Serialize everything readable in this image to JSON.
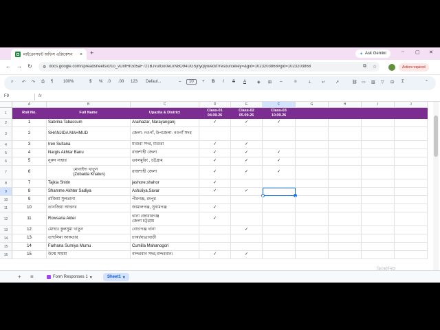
{
  "browser": {
    "tab_title": "মাইক্রোসফট অফিস এপ্লিকেশন",
    "tab_close": "×",
    "new_tab": "+",
    "gemini_label": "Ask Gemini",
    "url": "docs.google.com/spreadsheets/d/1o_vDnfHIGd5aF7z1BJvutGo0eLkN8O94UGSjriyqlyo/edit?resourcekey=&gid=1023203868#gid=1023203868",
    "action_required": "Action required",
    "win_min": "–",
    "win_max": "▢",
    "win_close": "✕",
    "back": "←",
    "forward": "→",
    "reload": "↻"
  },
  "toolbar": {
    "zoom": "100%",
    "currency": "$",
    "percent": "%",
    "format_123": "123",
    "font": "Defaul...",
    "font_size": "10",
    "bold": "B",
    "italic": "I",
    "strike": "S",
    "text_color": "A",
    "minus": "–",
    "plus": "+",
    "decimals_dec": ".0",
    "decimals_inc": ".00"
  },
  "formula_bar": {
    "cell_ref": "F9",
    "fx": "fx",
    "content": ""
  },
  "columns": [
    "A",
    "B",
    "C",
    "D",
    "E",
    "F",
    "G",
    "H",
    "I",
    "J"
  ],
  "header_row": {
    "roll": "Roll No.",
    "name": "Full Name",
    "upazila": "Upazila & District",
    "class1": "Class-01\n04.09.26",
    "class2": "Class-02\n05.09.26",
    "class3": "Class-03\n10.09.26"
  },
  "rows": [
    {
      "n": "2",
      "roll": "1",
      "name": "Sabrina Tabassum",
      "place": "Araihazar, Narayanganj",
      "c1": "✓",
      "c2": "✓",
      "c3": "✓"
    },
    {
      "n": "3",
      "roll": "2",
      "name": "SHANJIDA MAHMUD",
      "place": "জেলা- নওগাঁ, উপজেলা- নওগাঁ সদর",
      "c1": "",
      "c2": "",
      "c3": ""
    },
    {
      "n": "4",
      "roll": "3",
      "name": "Iren Sultana",
      "place": "মাগুরা সদর, মাগুরা",
      "c1": "✓",
      "c2": "✓",
      "c3": ""
    },
    {
      "n": "5",
      "roll": "4",
      "name": "Nargis Akhtar Banu",
      "place": "রাজশাহী জেলা",
      "c1": "✓",
      "c2": "✓",
      "c3": "✓"
    },
    {
      "n": "6",
      "roll": "5",
      "name": "নূরুন নাহার",
      "place": "ডবলমুরিং , চট্টগ্রাম",
      "c1": "✓",
      "c2": "✓",
      "c3": "✓"
    },
    {
      "n": "7",
      "roll": "6",
      "name": "মোবাইদা খাতুন\n(Zobaida Khatun)",
      "place": "রাজশাহী জেলা",
      "c1": "✓",
      "c2": "✓",
      "c3": "✓"
    },
    {
      "n": "8",
      "roll": "7",
      "name": "Tajkia Shirin",
      "place": "jashore,shahor",
      "c1": "✓",
      "c2": "",
      "c3": ""
    },
    {
      "n": "9",
      "roll": "8",
      "name": "Shamme Akhter Sadiya",
      "place": "Ashuliya,Savar",
      "c1": "✓",
      "c2": "✓",
      "c3": ""
    },
    {
      "n": "10",
      "roll": "9",
      "name": "রাজিয়া সুলতানা",
      "place": "পীরগঞ্জ, রংপুর",
      "c1": "",
      "c2": "",
      "c3": ""
    },
    {
      "n": "11",
      "roll": "10",
      "name": "তানজিয়া আক্তার",
      "place": "জামালগঞ্জ, সুনামগঞ্জ",
      "c1": "✓",
      "c2": "",
      "c3": ""
    },
    {
      "n": "12",
      "roll": "11",
      "name": "Rowsana Akter",
      "place": "থানা জোরারগঞ্জ\nজেলা চট্টগ্রাম",
      "c1": "✓",
      "c2": "",
      "c3": ""
    },
    {
      "n": "13",
      "roll": "12",
      "name": "মোছাঃ কুলসুমা খাতুন",
      "place": "বোচাগঞ্জ থানা",
      "c1": "",
      "c2": "✓",
      "c3": ""
    },
    {
      "n": "14",
      "roll": "13",
      "name": "তাছলিমা আকতার",
      "place": "ঢাকা/যাত্রাবাড়ী",
      "c1": "",
      "c2": "",
      "c3": ""
    },
    {
      "n": "15",
      "roll": "14",
      "name": "Farhana Sumiya Mumu",
      "place": "Cumilla Mahanogori",
      "c1": "",
      "c2": "",
      "c3": ""
    },
    {
      "n": "16",
      "roll": "15",
      "name": "উম্মে সায়মা",
      "place": "বান্দরবান সদর,বান্দরবান।",
      "c1": "✓",
      "c2": "✓",
      "c3": ""
    }
  ],
  "sheet_tabs": {
    "add": "+",
    "all": "≡",
    "form_responses": "Form Responses 1",
    "sheet1": "Sheet1",
    "dropdown": "▾"
  },
  "watermark": "ক্রিকেটপিয়া",
  "colors": {
    "header_purple": "#7b2d91",
    "selection_blue": "#1a73e8"
  }
}
